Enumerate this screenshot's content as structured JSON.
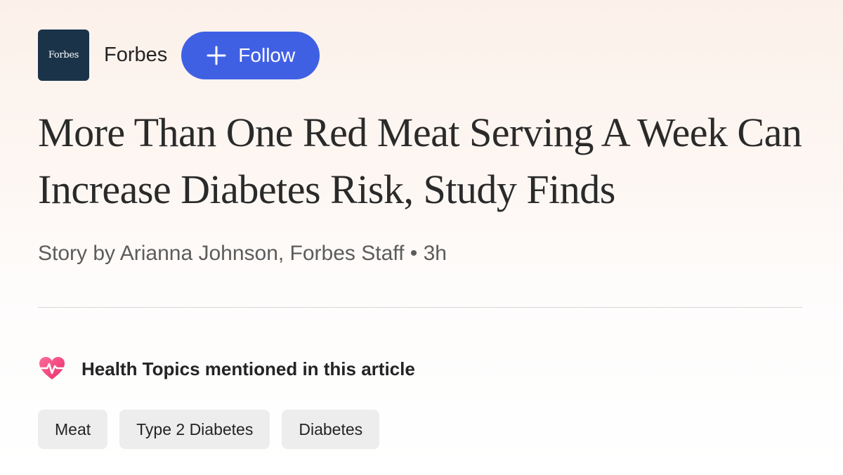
{
  "publisher": {
    "logo_text": "Forbes",
    "name": "Forbes",
    "follow_label": "Follow",
    "follow_icon": "plus-icon"
  },
  "article": {
    "headline": "More Than One Red Meat Serving A Week Can Increase Diabetes Risk, Study Finds",
    "byline": "Story by Arianna Johnson, Forbes Staff • 3h"
  },
  "health_topics": {
    "icon": "heart-pulse-icon",
    "title": "Health Topics mentioned in this article",
    "chips": [
      {
        "label": "Meat"
      },
      {
        "label": "Type 2 Diabetes"
      },
      {
        "label": "Diabetes"
      }
    ]
  },
  "colors": {
    "follow_button": "#4060e4",
    "logo_background": "#1a3348",
    "chip_background": "#ededed",
    "heart_pink": "#f0457f"
  }
}
